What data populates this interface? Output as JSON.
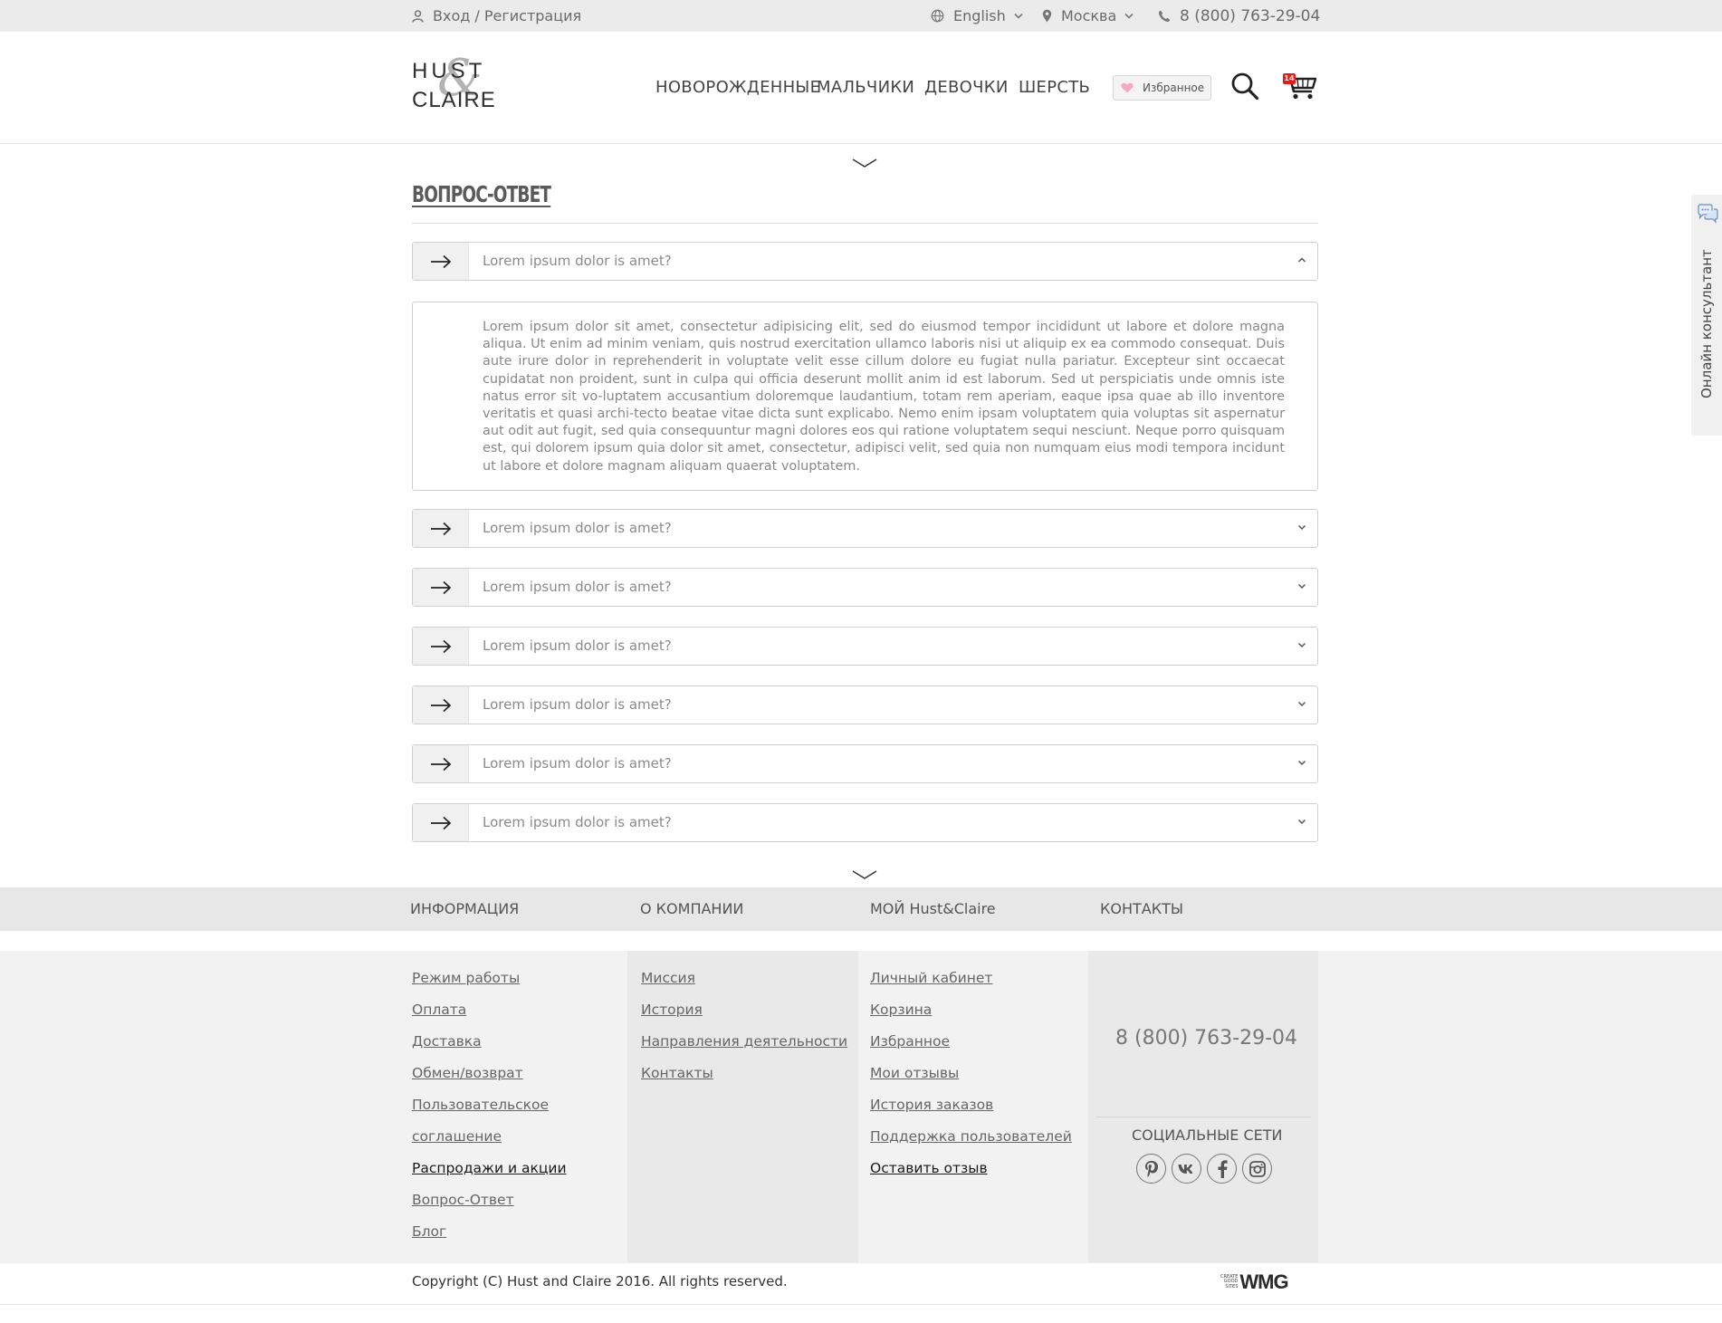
{
  "topbar": {
    "login_label": "Вход / Регистрация",
    "language": "English",
    "city": "Москва",
    "phone": "8 (800) 763-29-04"
  },
  "header": {
    "logo_line1": "HUST",
    "logo_amp": "&",
    "logo_line2": "CLAIRE",
    "nav": [
      "НОВОРОЖДЕННЫЕ",
      "МАЛЬЧИКИ",
      "ДЕВОЧКИ",
      "ШЕРСТЬ"
    ],
    "favorites_label": "Избранное",
    "cart_count": "14"
  },
  "faq": {
    "title": "ВОПРОС-ОТВЕТ",
    "items": [
      "Lorem ipsum dolor is amet?",
      "Lorem ipsum dolor is amet?",
      "Lorem ipsum dolor is amet?",
      "Lorem ipsum dolor is amet?",
      "Lorem ipsum dolor is amet?",
      "Lorem ipsum dolor is amet?",
      "Lorem ipsum dolor is amet?"
    ],
    "open_answer": "Lorem ipsum dolor sit amet, consectetur adipisicing elit, sed do eiusmod tempor incididunt ut labore et dolore magna aliqua. Ut enim ad minim veniam, quis nostrud exercitation ullamco laboris nisi ut aliquip ex ea commodo consequat. Duis aute irure dolor in reprehenderit in voluptate velit esse cillum dolore eu fugiat nulla pariatur. Excepteur sint occaecat cupidatat non proident, sunt in culpa qui officia deserunt mollit anim id est laborum. Sed ut perspiciatis unde omnis iste natus error sit vo-luptatem accusantium doloremque laudantium, totam rem aperiam, eaque ipsa quae ab illo inventore veritatis et quasi archi-tecto beatae vitae dicta sunt explicabo. Nemo enim ipsam voluptatem quia voluptas sit aspernatur aut odit aut fugit, sed quia consequuntur magni dolores eos qui ratione voluptatem sequi nesciunt. Neque porro quisquam est, qui dolorem ipsum quia dolor sit amet, consectetur, adipisci velit, sed quia non numquam eius modi tempora incidunt ut labore et dolore magnam aliquam quaerat voluptatem."
  },
  "footer": {
    "headings": [
      "ИНФОРМАЦИЯ",
      "О КОМПАНИИ",
      "МОЙ Hust&Claire",
      "КОНТАКТЫ"
    ],
    "info_links": [
      "Режим работы",
      "Оплата",
      "Доставка",
      "Обмен/возврат",
      "Пользовательское",
      "соглашение",
      "Распродажи и акции",
      "Вопрос-Ответ",
      "Блог"
    ],
    "company_links": [
      "Миссия",
      "История",
      "Направления деятельности",
      "Контакты "
    ],
    "account_links": [
      "Личный кабинет",
      "Корзина",
      "Избранное",
      "Мои отзывы",
      "История заказов",
      "Поддержка пользователей ",
      "Оставить отзыв"
    ],
    "phone": "8 (800) 763-29-04",
    "social_title": "СОЦИАЛЬНЫЕ СЕТИ",
    "social_icons": [
      "pinterest-icon",
      "vk-icon",
      "facebook-icon",
      "instagram-icon"
    ],
    "copyright": "Copyright (C) Hust and Claire 2016. All rights reserved.",
    "wmg_small": [
      "CREATE",
      "GOOD",
      "SITES"
    ],
    "wmg_logo": "WMG"
  },
  "consultant": {
    "label": "Онлайн консультант"
  },
  "colors": {
    "cart_badge": "#e21b1b",
    "heart": "#f7a9c9"
  }
}
